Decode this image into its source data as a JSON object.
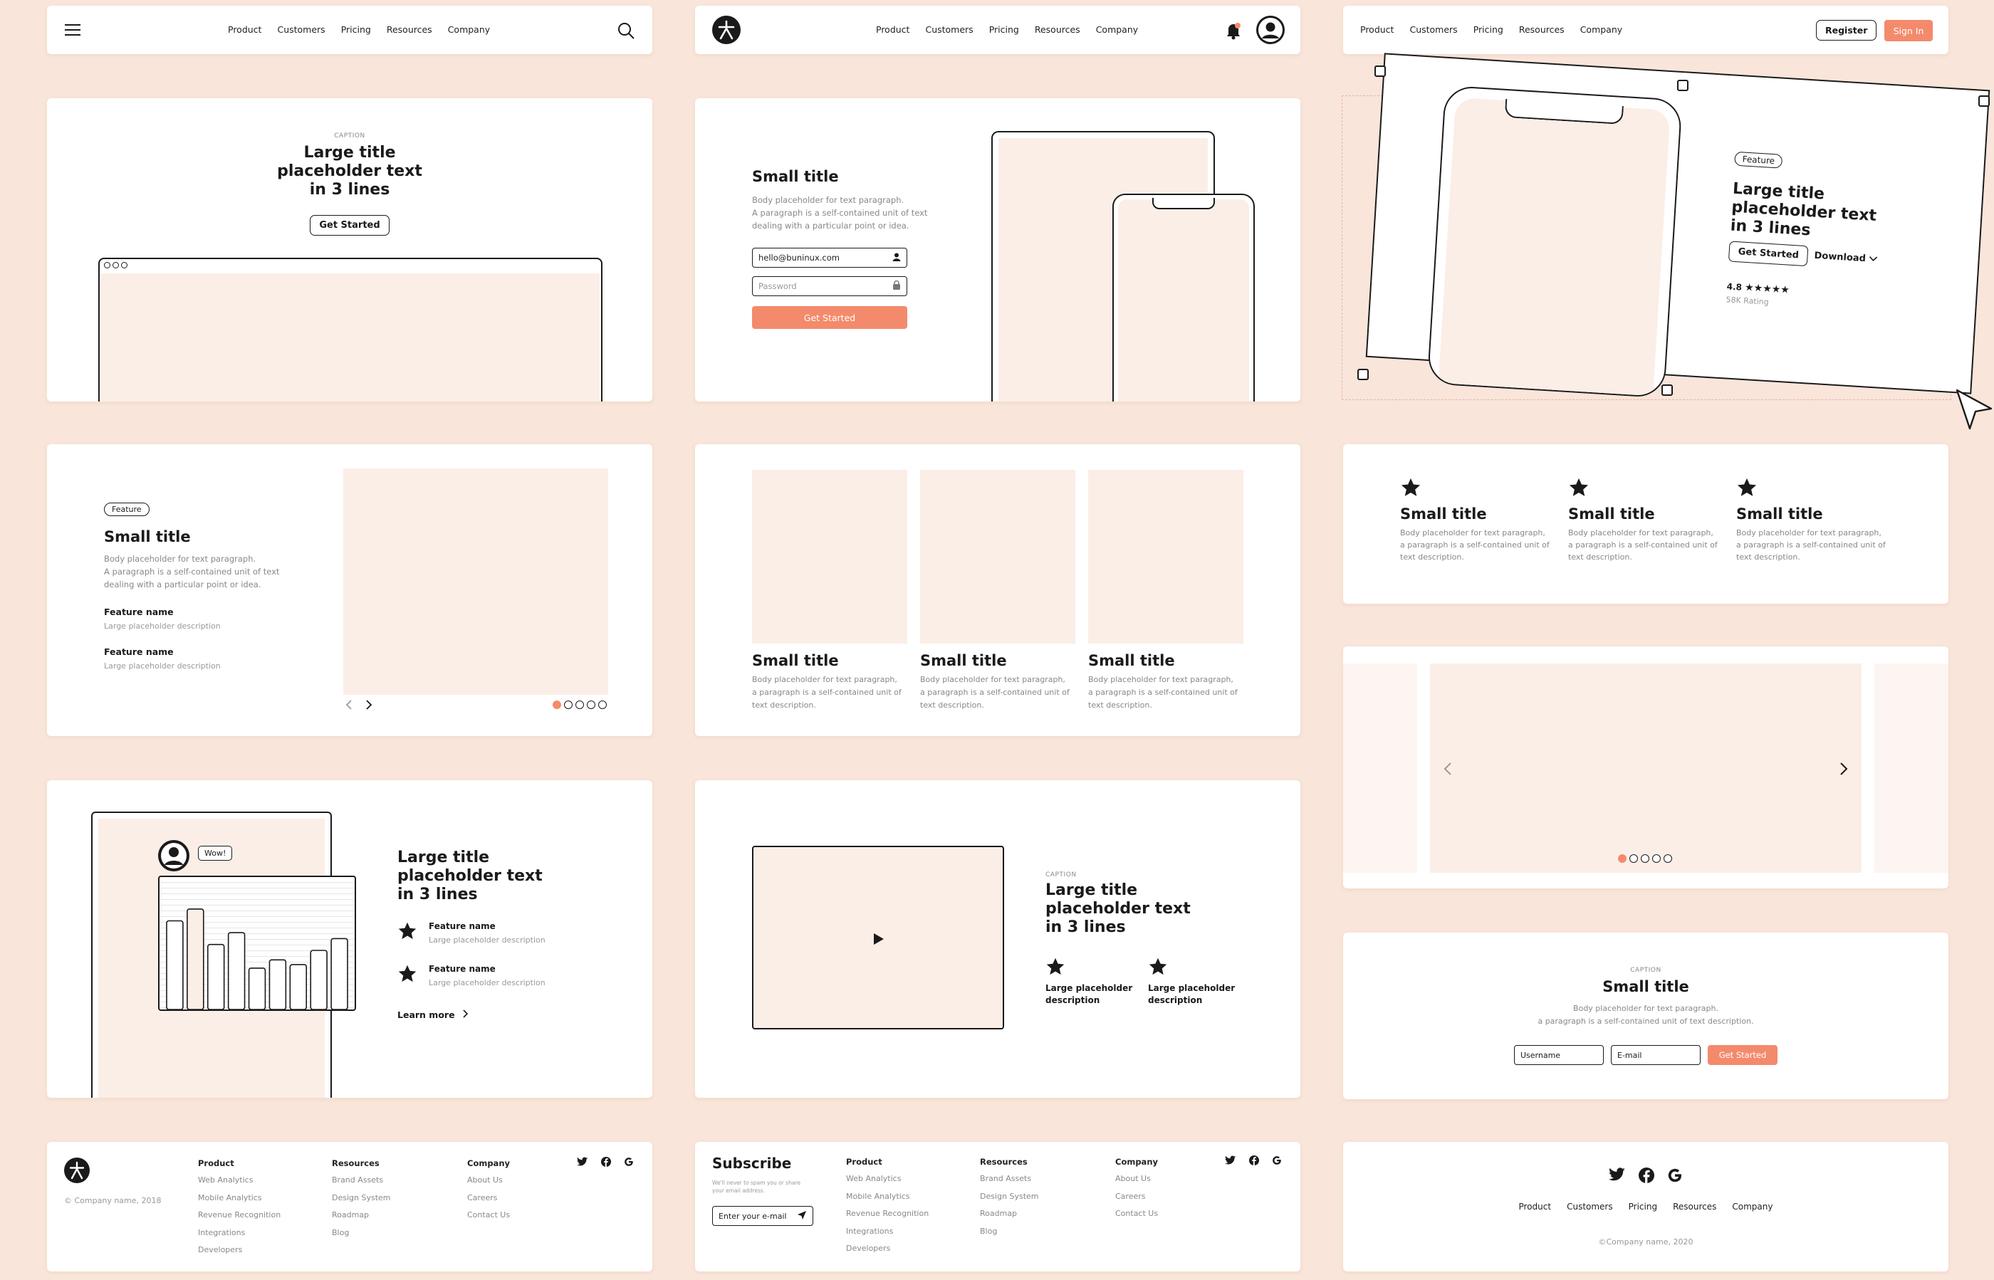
{
  "nav": [
    "Product",
    "Customers",
    "Pricing",
    "Resources",
    "Company"
  ],
  "header3": {
    "register": "Register",
    "signin": "Sign In"
  },
  "hero1": {
    "caption": "CAPTION",
    "title": [
      "Large title",
      "placeholder text",
      "in 3 lines"
    ],
    "button": "Get Started"
  },
  "login": {
    "title": "Small title",
    "body": [
      "Body placeholder for text paragraph.",
      "A paragraph is a self-contained unit of text",
      "dealing with a particular point or idea."
    ],
    "email_value": "hello@buninux.com",
    "password_placeholder": "Password",
    "button": "Get Started"
  },
  "hero3": {
    "badge": "Feature",
    "title": [
      "Large title",
      "placeholder text",
      "in 3 lines"
    ],
    "button": "Get Started",
    "download": "Download",
    "rating": "4.8",
    "stars": "★★★★★",
    "rating_label": "58K Rating"
  },
  "feature_slider": {
    "badge": "Feature",
    "title": "Small title",
    "body": [
      "Body placeholder for text paragraph.",
      "A paragraph is a self-contained unit of text",
      "dealing with a particular point or idea."
    ],
    "items": [
      {
        "name": "Feature name",
        "desc": "Large placeholder description"
      },
      {
        "name": "Feature name",
        "desc": "Large placeholder description"
      }
    ]
  },
  "three_cards": [
    {
      "title": "Small title",
      "body": [
        "Body placeholder for text paragraph,",
        "a paragraph is a self-contained unit of",
        "text description."
      ]
    },
    {
      "title": "Small title",
      "body": [
        "Body placeholder for text paragraph,",
        "a paragraph is a self-contained unit of",
        "text description."
      ]
    },
    {
      "title": "Small title",
      "body": [
        "Body placeholder for text paragraph,",
        "a paragraph is a self-contained unit of",
        "text description."
      ]
    }
  ],
  "three_stars": [
    {
      "title": "Small title",
      "body": [
        "Body placeholder for text paragraph,",
        "a paragraph is a self-contained unit of",
        "text description."
      ]
    },
    {
      "title": "Small title",
      "body": [
        "Body placeholder for text paragraph,",
        "a paragraph is a self-contained unit of",
        "text description."
      ]
    },
    {
      "title": "Small title",
      "body": [
        "Body placeholder for text paragraph,",
        "a paragraph is a self-contained unit of",
        "text description."
      ]
    }
  ],
  "chat": {
    "bubble": "Wow!",
    "title": [
      "Large title",
      "placeholder text",
      "in 3 lines"
    ],
    "items": [
      {
        "name": "Feature name",
        "desc": "Large placeholder description"
      },
      {
        "name": "Feature name",
        "desc": "Large placeholder description"
      }
    ],
    "learn_more": "Learn more",
    "bars": [
      0.75,
      0.85,
      0.55,
      0.65,
      0.35,
      0.42,
      0.38,
      0.5,
      0.6
    ],
    "highlight_index": 1
  },
  "video": {
    "caption": "CAPTION",
    "title": [
      "Large title",
      "placeholder text",
      "in 3 lines"
    ],
    "items": [
      [
        "Large placeholder",
        "description"
      ],
      [
        "Large placeholder",
        "description"
      ]
    ]
  },
  "subscribe_card": {
    "caption": "CAPTION",
    "title": "Small title",
    "body": [
      "Body placeholder for text paragraph.",
      "a paragraph is a self-contained unit of text description."
    ],
    "username": "Username",
    "email": "E-mail",
    "button": "Get Started"
  },
  "footer1": {
    "copyright": "© Company name, 2018"
  },
  "footer_cols": [
    {
      "head": "Product",
      "links": [
        "Web Analytics",
        "Mobile Analytics",
        "Revenue Recognition",
        "Integrations",
        "Developers"
      ]
    },
    {
      "head": "Resources",
      "links": [
        "Brand Assets",
        "Design System",
        "Roadmap",
        "Blog"
      ]
    },
    {
      "head": "Company",
      "links": [
        "About Us",
        "Careers",
        "Contact Us"
      ]
    }
  ],
  "footer2": {
    "title": "Subscribe",
    "note": [
      "We'll never to spam you or share",
      "your email address."
    ],
    "input_placeholder": "Enter your e-mail"
  },
  "footer3": {
    "copyright": "©Company name, 2020"
  },
  "colors": {
    "accent": "#f48a6c",
    "placeholder": "#fbeee7",
    "background": "#f9e5da"
  }
}
